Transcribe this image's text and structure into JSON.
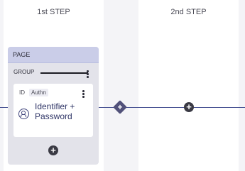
{
  "steps": [
    {
      "title": "1st STEP"
    },
    {
      "title": "2nd STEP"
    }
  ],
  "page": {
    "label": "PAGE",
    "group": {
      "label": "GROUP",
      "authenticator": {
        "id_label": "ID",
        "type_label": "Authn",
        "name": "Identifier + Password",
        "icon": "user-password-icon"
      }
    }
  },
  "connectors": {
    "add_symbol": "+"
  },
  "colors": {
    "accent": "#4b5594",
    "page_header": "#cacde8"
  }
}
